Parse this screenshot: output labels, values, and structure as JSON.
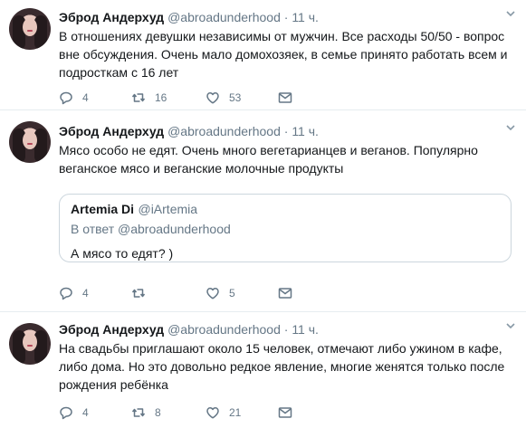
{
  "tweets": [
    {
      "name": "Эброд Андерхуд",
      "handle": "@abroadunderhood",
      "dot": "·",
      "time": "11 ч.",
      "lines": [
        "В отношениях девушки независимы от мужчин. Все расходы 50/50 - вопрос",
        "вне обсуждения. Очень мало домохозяек, в семье принято работать всем и",
        "подросткам с 16 лет"
      ],
      "replies": "4",
      "retweets": "16",
      "likes": "53"
    },
    {
      "name": "Эброд Андерхуд",
      "handle": "@abroadunderhood",
      "dot": "·",
      "time": "11 ч.",
      "lines": [
        "Мясо особо не едят. Очень много вегетарианцев и веганов. Популярно",
        "веганское мясо и веганские молочные продукты"
      ],
      "quote": {
        "name": "Artemia Di",
        "handle": "@iArtemia",
        "reply_to": "В ответ @abroadunderhood",
        "text": "А мясо то едят? )"
      },
      "replies": "4",
      "retweets": "",
      "likes": "5"
    },
    {
      "name": "Эброд Андерхуд",
      "handle": "@abroadunderhood",
      "dot": "·",
      "time": "11 ч.",
      "lines": [
        "На свадьбы приглашают около 15 человек, отмечают либо ужином в кафе,",
        "либо дома. Но это довольно редкое явление, многие женятся только после",
        "рождения ребёнка"
      ],
      "replies": "4",
      "retweets": "8",
      "likes": "21"
    }
  ],
  "icons": {
    "reply": "reply-icon",
    "retweet": "retweet-icon",
    "like": "heart-icon",
    "dm": "envelope-icon",
    "more": "chevron-down-icon",
    "avatar": "avatar"
  },
  "colors": {
    "text": "#14171a",
    "secondary": "#657786",
    "border": "#e6ecf0",
    "quote_border": "#ccd6dd"
  }
}
